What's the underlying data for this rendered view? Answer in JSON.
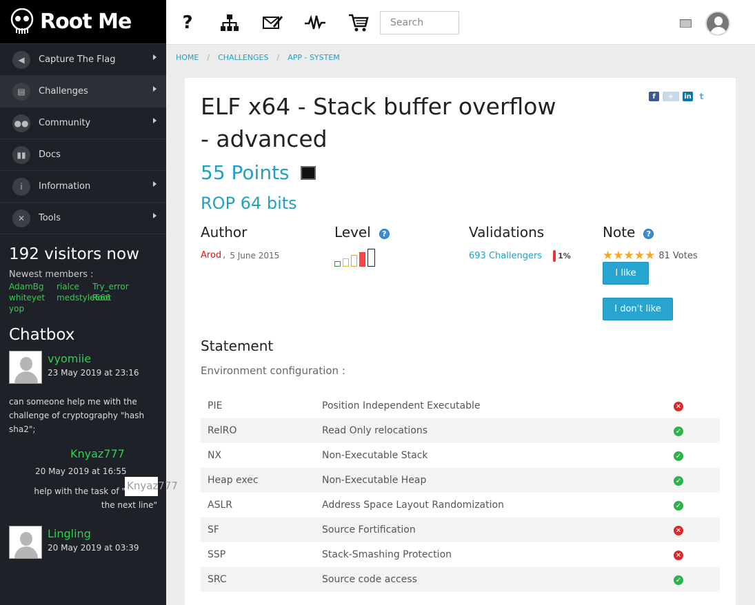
{
  "brand": {
    "name": "Root Me"
  },
  "sidebar": {
    "items": [
      {
        "label": "Capture The Flag",
        "icon": "flag-icon",
        "arrow": true
      },
      {
        "label": "Challenges",
        "icon": "challenges-icon",
        "arrow": true
      },
      {
        "label": "Community",
        "icon": "community-icon",
        "arrow": true
      },
      {
        "label": "Docs",
        "icon": "docs-icon",
        "arrow": false
      },
      {
        "label": "Information",
        "icon": "information-icon",
        "arrow": true
      },
      {
        "label": "Tools",
        "icon": "tools-icon",
        "arrow": true
      }
    ],
    "visitors": "192 visitors now",
    "newest_label": "Newest members :",
    "members": [
      "AdamBg",
      "rialce",
      "Try_error",
      "whiteyet",
      "medstyle666",
      "Root",
      "yop"
    ],
    "chatbox_title": "Chatbox",
    "chats": [
      {
        "user": "vyomiie",
        "date": "23 May 2019 at 23:16",
        "message": "can someone help me with the challenge of cryptography \"hash sha2\";"
      },
      {
        "user": "Knyaz777",
        "date": "20 May 2019 at 16:55",
        "message": "help with the task of \"dot and the next line\""
      },
      {
        "user": "Lingling",
        "date": "20 May 2019 at 03:39"
      }
    ],
    "ghost_name": "Knyaz777"
  },
  "topbar": {
    "search_placeholder": "Search",
    "icons": [
      "help-icon",
      "sitemap-icon",
      "messages-icon",
      "activity-icon",
      "cart-icon"
    ]
  },
  "breadcrumb": {
    "home": "HOME",
    "challenges": "CHALLENGES",
    "category": "APP - SYSTEM",
    "separator": "/"
  },
  "challenge": {
    "title": "ELF x64 - Stack buffer overflow - advanced",
    "points": "55 Points",
    "subtitle": "ROP 64 bits",
    "author_label": "Author",
    "author": "Arod",
    "author_date": "5 June 2015",
    "level_label": "Level",
    "level": 4,
    "level_max": 5,
    "validations_label": "Validations",
    "validations": "693 Challengers",
    "validation_pct": "1%",
    "note_label": "Note",
    "stars": 5,
    "votes": "81 Votes",
    "like_label": "I like",
    "dislike_label": "I don't like",
    "statement_label": "Statement",
    "env_label": "Environment configuration :",
    "env": [
      {
        "code": "PIE",
        "description": "Position Independent Executable",
        "enabled": false
      },
      {
        "code": "RelRO",
        "description": "Read Only relocations",
        "enabled": true
      },
      {
        "code": "NX",
        "description": "Non-Executable Stack",
        "enabled": true
      },
      {
        "code": "Heap exec",
        "description": "Non-Executable Heap",
        "enabled": true
      },
      {
        "code": "ASLR",
        "description": "Address Space Layout Randomization",
        "enabled": true
      },
      {
        "code": "SF",
        "description": "Source Fortification",
        "enabled": false
      },
      {
        "code": "SSP",
        "description": "Stack-Smashing Protection",
        "enabled": false
      },
      {
        "code": "SRC",
        "description": "Source code access",
        "enabled": true
      }
    ]
  },
  "colors": {
    "accent": "#1fa0c6",
    "sidebar_bg": "#1e2127",
    "member_green": "#2ad34a",
    "author_red": "#e11111"
  }
}
